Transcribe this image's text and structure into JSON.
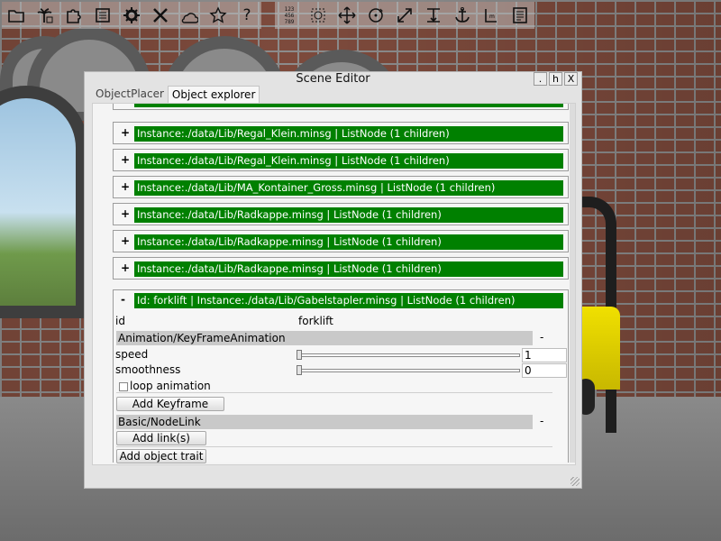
{
  "toolbar": {
    "buttons": [
      {
        "icon": "folder-icon"
      },
      {
        "icon": "palm-tree-icon"
      },
      {
        "icon": "puzzle-icon"
      },
      {
        "icon": "list-icon"
      },
      {
        "icon": "gear-icon"
      },
      {
        "icon": "crossed-tools-icon"
      },
      {
        "icon": "weather-icon"
      },
      {
        "icon": "star-icon"
      },
      {
        "icon": "help-icon"
      }
    ],
    "transform_buttons": [
      {
        "icon": "number-grid-icon"
      },
      {
        "icon": "select-icon"
      },
      {
        "icon": "move-icon"
      },
      {
        "icon": "rotate-icon"
      },
      {
        "icon": "scale-icon"
      },
      {
        "icon": "snap-floor-icon"
      },
      {
        "icon": "anchor-icon"
      },
      {
        "icon": "measure-icon"
      },
      {
        "icon": "properties-icon"
      }
    ],
    "help_glyph": "?",
    "grid_glyph": "123\n456\n789"
  },
  "dialog": {
    "title": "Scene Editor",
    "buttons": [
      ".",
      "h",
      "X"
    ],
    "tabs": [
      {
        "label": "ObjectPlacer",
        "active": false
      },
      {
        "label": "Object explorer",
        "active": true
      }
    ]
  },
  "nodes": [
    {
      "toggle": "+",
      "label": "Instance:./data/Lib/Regal_Klein.minsg | ListNode (1 children)"
    },
    {
      "toggle": "+",
      "label": "Instance:./data/Lib/Regal_Klein.minsg | ListNode (1 children)"
    },
    {
      "toggle": "+",
      "label": "Instance:./data/Lib/MA_Kontainer_Gross.minsg | ListNode (1 children)"
    },
    {
      "toggle": "+",
      "label": "Instance:./data/Lib/Radkappe.minsg | ListNode (1 children)"
    },
    {
      "toggle": "+",
      "label": "Instance:./data/Lib/Radkappe.minsg | ListNode (1 children)"
    },
    {
      "toggle": "+",
      "label": "Instance:./data/Lib/Radkappe.minsg | ListNode (1 children)"
    }
  ],
  "open_node": {
    "toggle": "-",
    "label": "Id: forklift | Instance:./data/Lib/Gabelstapler.minsg | ListNode (1 children)",
    "id_label": "id",
    "id_value": "forklift",
    "animation": {
      "section": "Animation/KeyFrameAnimation",
      "minimize": "-",
      "speed_label": "speed",
      "speed_value": "1",
      "speed_fraction": 0.0,
      "smoothness_label": "smoothness",
      "smoothness_value": "0",
      "smoothness_fraction": 0.0,
      "loop_label": "loop animation",
      "loop_checked": false,
      "add_keyframe": "Add Keyframe"
    },
    "nodelink": {
      "section": "Basic/NodeLink",
      "minimize": "-",
      "add_links": "Add link(s)"
    },
    "add_trait": "Add object trait"
  },
  "colors": {
    "node_label_bg": "#008000",
    "section_bar": "#c9c9c9",
    "forklift": "#f0e000"
  }
}
